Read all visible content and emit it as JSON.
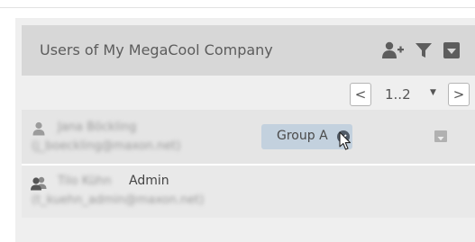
{
  "panel": {
    "title": "Users of My MegaCool Company",
    "header_icons": [
      "add-user-icon",
      "filter-icon",
      "collapse-icon"
    ]
  },
  "pager": {
    "prev_label": "<",
    "range": "1..2",
    "caret": "▼",
    "next_label": ">"
  },
  "users": [
    {
      "name": "Jana Böckling",
      "email": "(j_boeckling@maxon.net)",
      "role": "",
      "icon": "user-icon",
      "group_chip": "Group A",
      "name_blurred": true
    },
    {
      "name": "Tilo Kühn",
      "email": "(t_kuehn_admin@maxon.net)",
      "role": "Admin",
      "icon": "admin-users-icon",
      "name_blurred": true
    }
  ],
  "colors": {
    "header_bg": "#d7d7d7",
    "panel_bg": "#efefef",
    "chip_bg": "#c3d1de",
    "icon_gray": "#5d5d5d"
  }
}
